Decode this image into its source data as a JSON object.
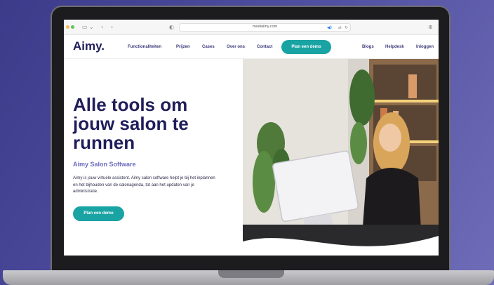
{
  "browser": {
    "url": "meetaimy.com",
    "sidebar_icon": "sidebar-icon",
    "back_icon": "chevron-left-icon",
    "forward_icon": "chevron-right-icon",
    "shield_icon": "shield-icon",
    "download_icon": "download-icon"
  },
  "nav": {
    "logo": "Aimy.",
    "links": [
      "Functionaliteiten",
      "Prijzen",
      "Cases",
      "Over ons",
      "Contact"
    ],
    "cta": "Plan een demo",
    "right_links": [
      "Blogs",
      "Helpdesk",
      "Inloggen"
    ]
  },
  "hero": {
    "title_line1": "Alle tools om",
    "title_line2": "jouw salon te",
    "title_line3": "runnen",
    "subtitle": "Aimy Salon Software",
    "body": "Aimy is jouw virtuele assistent. Aimy salon software helpt je bij het inplannen en het bijhouden van de salonagenda, tot aan het updaten van je administratie.",
    "cta": "Plan een demo"
  },
  "colors": {
    "brand_navy": "#1f1d5a",
    "accent_teal": "#19a3a3",
    "subtitle_purple": "#6b6bbf",
    "background": "#4e4d9e"
  }
}
